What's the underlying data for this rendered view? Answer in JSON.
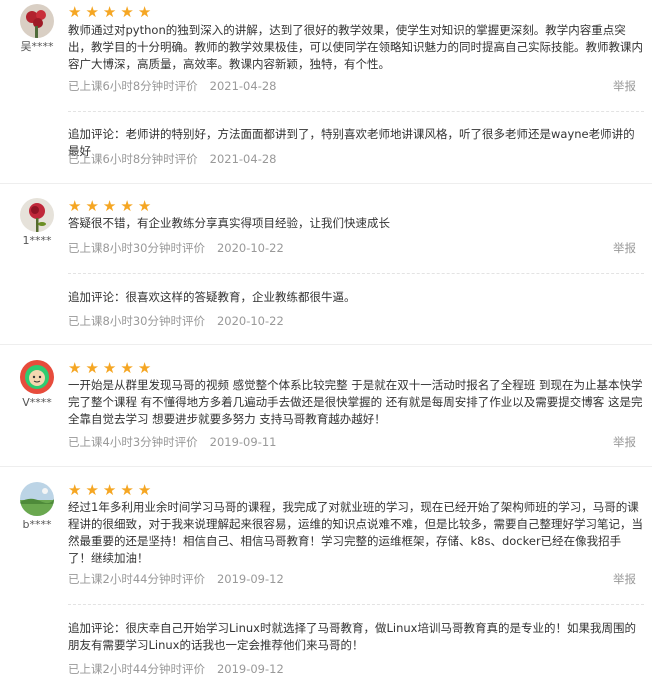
{
  "colors": {
    "star": "#f5a623",
    "muted": "#999999",
    "text": "#333333"
  },
  "star_icon": "★",
  "reviews": [
    {
      "user": "吴****",
      "avatar": "red-flowers-avatar",
      "rating": 5,
      "content": "教师通过对python的独到深入的讲解，达到了很好的教学效果，使学生对知识的掌握更深刻。教学内容重点突出，教学目的十分明确。教师的教学效果极佳，可以使同学在领略知识魅力的同时提高自己实际技能。教师教课内容广大博深，高质量，高效率。教课内容新颖，独特，有个性。",
      "status": "已上课6小时8分钟时评价",
      "date": "2021-04-28",
      "report": "举报",
      "followup": "追加评论：老师讲的特别好，方法面面都讲到了，特别喜欢老师地讲课风格，听了很多老师还是wayne老师讲的最好",
      "followup_status": "已上课6小时8分钟时评价",
      "followup_date": "2021-04-28"
    },
    {
      "user": "1****",
      "avatar": "red-rose-avatar",
      "rating": 5,
      "content": "答疑很不错，有企业教练分享真实得项目经验，让我们快速成长",
      "status": "已上课8小时30分钟时评价",
      "date": "2020-10-22",
      "report": "举报",
      "followup": "追加评论：很喜欢这样的答疑教育，企业教练都很牛逼。",
      "followup_status": "已上课8小时30分钟时评价",
      "followup_date": "2020-10-22"
    },
    {
      "user": "V****",
      "avatar": "cartoon-avatar",
      "rating": 5,
      "content": "一开始是从群里发现马哥的视频 感觉整个体系比较完整 于是就在双十一活动时报名了全程班 到现在为止基本快学完了整个课程 有不懂得地方多着几遍动手去做还是很快掌握的 还有就是每周安排了作业以及需要提交博客 这是完全靠自觉去学习 想要进步就要多努力 支持马哥教育越办越好！",
      "status": "已上课4小时3分钟时评价",
      "date": "2019-09-11",
      "report": "举报"
    },
    {
      "user": "b****",
      "avatar": "landscape-avatar",
      "rating": 5,
      "content": "经过1年多利用业余时间学习马哥的课程，我完成了对就业班的学习，现在已经开始了架构师班的学习，马哥的课程讲的很细致，对于我来说理解起来很容易，运维的知识点说难不难，但是比较多，需要自己整理好学习笔记，当然最重要的还是坚持！相信自己、相信马哥教育！学习完整的运维框架，存储、k8s、docker已经在像我招手了！继续加油！",
      "status": "已上课2小时44分钟时评价",
      "date": "2019-09-12",
      "report": "举报",
      "followup": "追加评论：很庆幸自己开始学习Linux时就选择了马哥教育，做Linux培训马哥教育真的是专业的！如果我周围的朋友有需要学习Linux的话我也一定会推荐他们来马哥的！",
      "followup_status": "已上课2小时44分钟时评价",
      "followup_date": "2019-09-12"
    }
  ]
}
